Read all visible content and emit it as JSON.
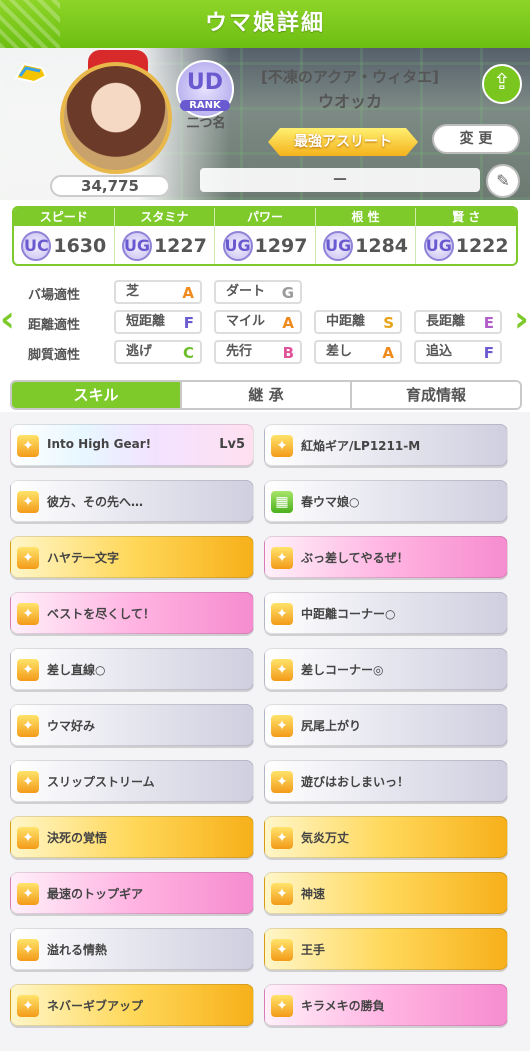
{
  "header": {
    "title": "ウマ娘詳細"
  },
  "profile": {
    "rank_badge": "UD",
    "rank_label": "RANK",
    "nickname": "二つ名",
    "epithet": "[不凍のアクア・ウィタエ]",
    "name": "ウオッカ",
    "title_badge": "最強アスリート",
    "change_button": "変 更",
    "score": "34,775",
    "trainer_field": "－",
    "share_icon": "share-icon",
    "edit_icon": "pencil-icon"
  },
  "stats": [
    {
      "label": "スピード",
      "grade": "UC",
      "grade_sub": "3",
      "value": "1630"
    },
    {
      "label": "スタミナ",
      "grade": "UG",
      "grade_sub": "2",
      "value": "1227"
    },
    {
      "label": "パワー",
      "grade": "UG",
      "grade_sub": "9",
      "value": "1297"
    },
    {
      "label": "根 性",
      "grade": "UG",
      "grade_sub": "8",
      "value": "1284"
    },
    {
      "label": "賢 さ",
      "grade": "UG",
      "grade_sub": "2",
      "value": "1222"
    }
  ],
  "aptitude": {
    "track_label": "バ場適性",
    "track": [
      {
        "name": "芝",
        "grade": "A"
      },
      {
        "name": "ダート",
        "grade": "G"
      }
    ],
    "distance_label": "距離適性",
    "distance": [
      {
        "name": "短距離",
        "grade": "F"
      },
      {
        "name": "マイル",
        "grade": "A"
      },
      {
        "name": "中距離",
        "grade": "S"
      },
      {
        "name": "長距離",
        "grade": "E"
      }
    ],
    "style_label": "脚質適性",
    "style": [
      {
        "name": "逃げ",
        "grade": "C"
      },
      {
        "name": "先行",
        "grade": "B"
      },
      {
        "name": "差し",
        "grade": "A"
      },
      {
        "name": "追込",
        "grade": "F"
      }
    ]
  },
  "tabs": [
    "スキル",
    "継 承",
    "育成情報"
  ],
  "skills": [
    {
      "name": "Into High Gear!",
      "level": "Lv5",
      "style": "rainbow"
    },
    {
      "name": "紅焔ギア/LP1211-M",
      "level": "",
      "style": "silver"
    },
    {
      "name": "彼方、その先へ…",
      "level": "",
      "style": "silver"
    },
    {
      "name": "春ウマ娘○",
      "level": "",
      "style": "silver"
    },
    {
      "name": "ハヤテ一文字",
      "level": "",
      "style": "gold"
    },
    {
      "name": "ぶっ差してやるぜ！",
      "level": "",
      "style": "pink"
    },
    {
      "name": "ベストを尽くして！",
      "level": "",
      "style": "pink"
    },
    {
      "name": "中距離コーナー○",
      "level": "",
      "style": "silver"
    },
    {
      "name": "差し直線○",
      "level": "",
      "style": "silver"
    },
    {
      "name": "差しコーナー◎",
      "level": "",
      "style": "silver"
    },
    {
      "name": "ウマ好み",
      "level": "",
      "style": "silver"
    },
    {
      "name": "尻尾上がり",
      "level": "",
      "style": "silver"
    },
    {
      "name": "スリップストリーム",
      "level": "",
      "style": "silver"
    },
    {
      "name": "遊びはおしまいっ！",
      "level": "",
      "style": "silver"
    },
    {
      "name": "決死の覚悟",
      "level": "",
      "style": "gold"
    },
    {
      "name": "気炎万丈",
      "level": "",
      "style": "gold"
    },
    {
      "name": "最速のトップギア",
      "level": "",
      "style": "pink"
    },
    {
      "name": "神速",
      "level": "",
      "style": "gold"
    },
    {
      "name": "溢れる情熱",
      "level": "",
      "style": "silver"
    },
    {
      "name": "王手",
      "level": "",
      "style": "gold"
    },
    {
      "name": "ネバーギブアップ",
      "level": "",
      "style": "gold"
    },
    {
      "name": "キラメキの勝負",
      "level": "",
      "style": "pink"
    }
  ],
  "colors": {
    "accent": "#7dca2a",
    "grade_A": "#f08a1c",
    "grade_S": "#e8a317",
    "grade_B": "#e0539a",
    "grade_C": "#6cbf2a",
    "grade_E": "#b15cc9",
    "grade_F": "#6a5ad0",
    "grade_G": "#9a9a9a"
  }
}
